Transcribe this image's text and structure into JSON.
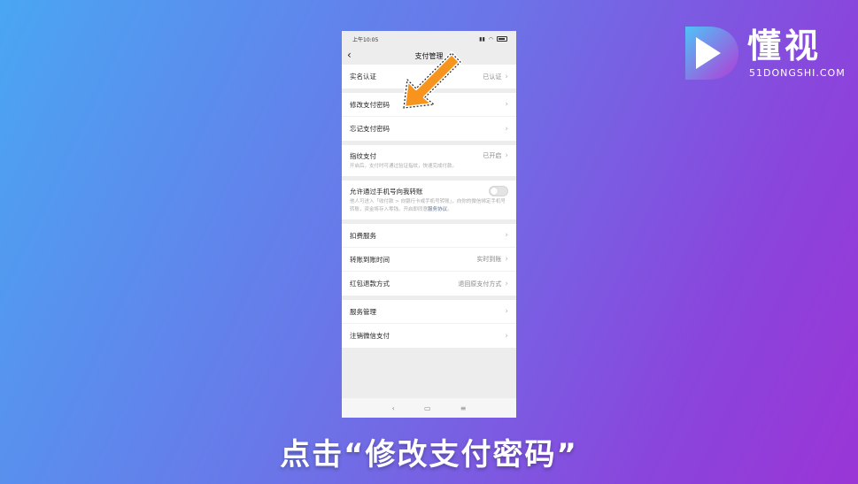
{
  "logo": {
    "cn": "懂视",
    "en": "51DONGSHI.COM"
  },
  "status_bar": {
    "time": "上午10:05"
  },
  "nav": {
    "title": "支付管理"
  },
  "groups": {
    "verify": {
      "label": "实名认证",
      "value": "已认证"
    },
    "password": {
      "change": "修改支付密码",
      "forgot": "忘记支付密码"
    },
    "fingerprint": {
      "label": "指纹支付",
      "value": "已开启",
      "desc": "开启后，支付时可通过验证指纹，快速完成付款。"
    },
    "transfer": {
      "label": "允许通过手机号向我转账",
      "desc_prefix": "他人可进入「收付款 > 向银行卡或手机号转账」，向你的微信绑定手机号转账，资金将存入零钱。开启即同意",
      "desc_link": "服务协议",
      "desc_suffix": "。"
    },
    "services": {
      "deduct": "扣费服务",
      "arrival": {
        "label": "转账到账时间",
        "value": "实时到账"
      },
      "refund": {
        "label": "红包退款方式",
        "value": "退回原支付方式"
      }
    },
    "manage": {
      "service": "服务管理",
      "cancel": "注销微信支付"
    }
  },
  "caption": "点击“修改支付密码”",
  "colors": {
    "arrow": "#f7941d",
    "link": "#576b95"
  }
}
